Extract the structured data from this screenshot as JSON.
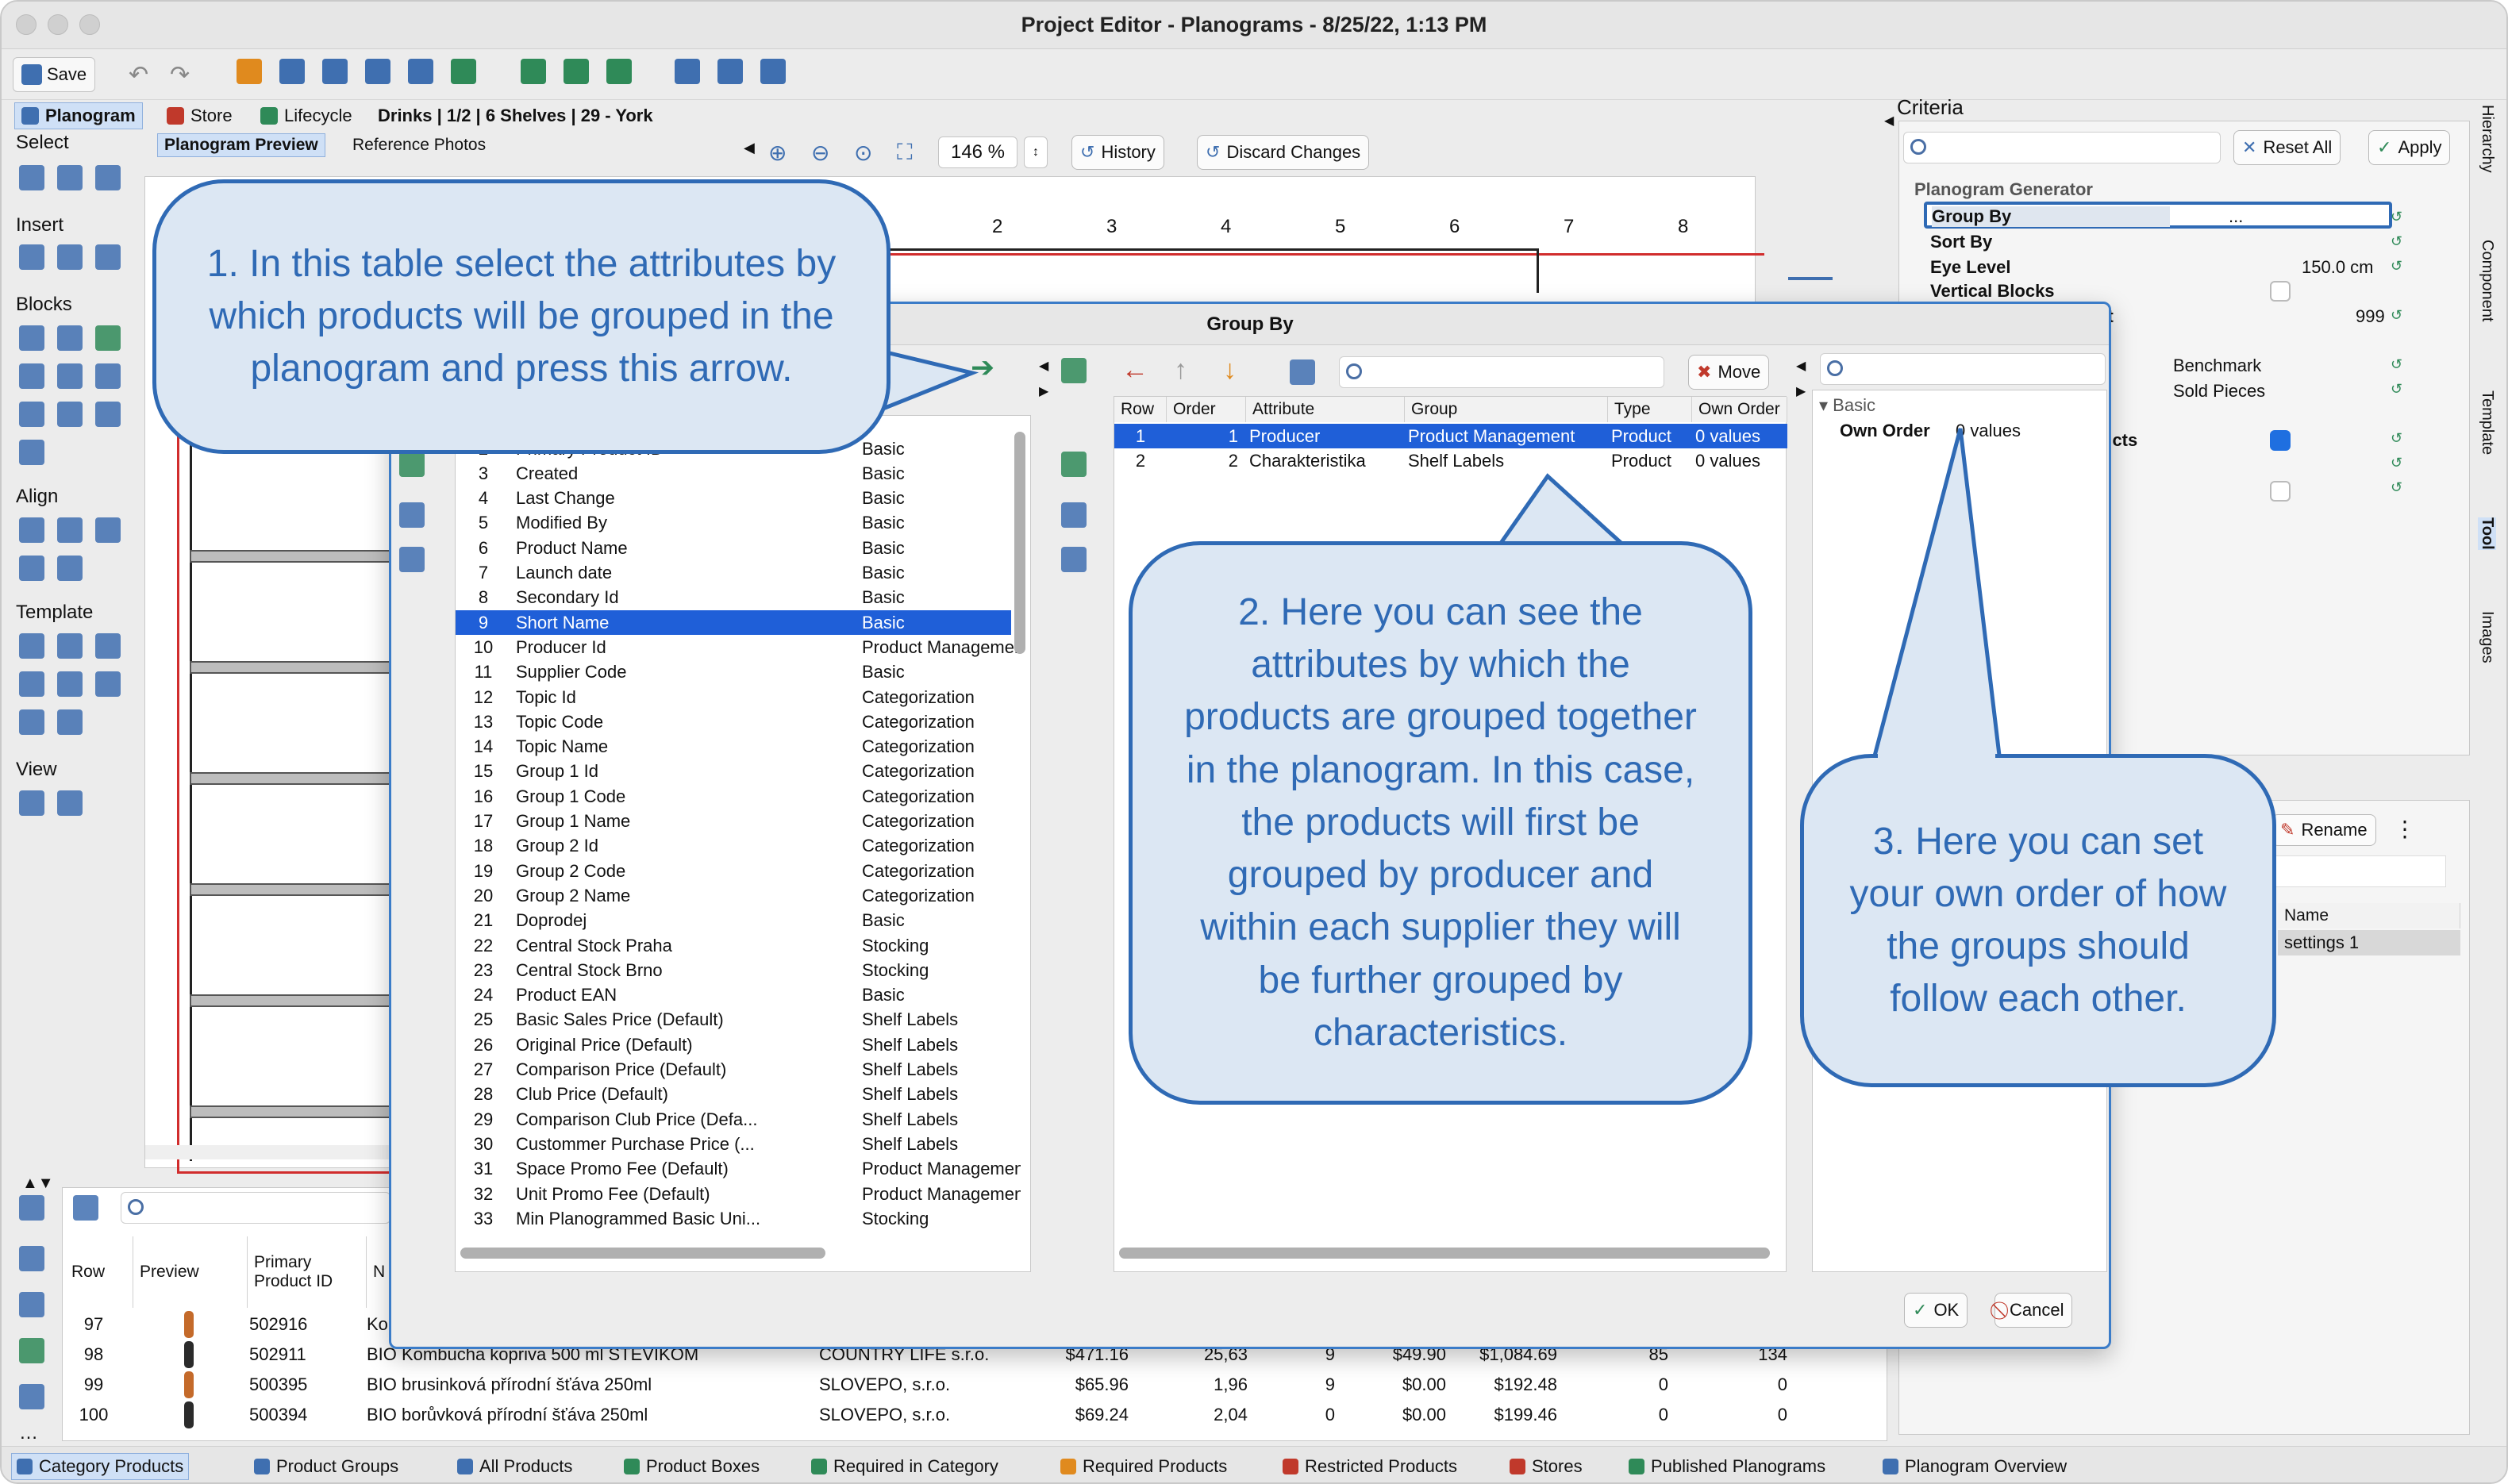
{
  "window": {
    "title": "Project Editor - Planograms - 8/25/22, 1:13 PM"
  },
  "toolbar": {
    "save_label": "Save"
  },
  "tabs": {
    "planogram": "Planogram",
    "store": "Store",
    "lifecycle": "Lifecycle",
    "path": "Drinks | 1/2 | 6 Shelves | 29 - York",
    "preview": "Planogram Preview",
    "photos": "Reference Photos"
  },
  "zoom": {
    "value": "146 %"
  },
  "actions": {
    "history": "History",
    "discard": "Discard Changes"
  },
  "sections": {
    "select": "Select",
    "insert": "Insert",
    "blocks": "Blocks",
    "align": "Align",
    "template": "Template",
    "view": "View"
  },
  "ruler": [
    "2",
    "3",
    "4",
    "5",
    "6",
    "7",
    "8"
  ],
  "criteria": {
    "title": "Criteria",
    "reset": "Reset All",
    "apply": "Apply",
    "generator": "Planogram Generator",
    "rows": [
      {
        "label": "Group By",
        "value": "..."
      },
      {
        "label": "Sort By",
        "value": ""
      },
      {
        "label": "Eye Level",
        "value": "150.0 cm"
      },
      {
        "label": "Vertical Blocks",
        "value": ""
      }
    ],
    "ht_label": "ht",
    "ht_value": "999",
    "benchmark": "Benchmark",
    "sold": "Sold Pieces",
    "ucts": "ucts"
  },
  "right_lower": {
    "rename": "Rename",
    "name_header": "Name",
    "name_value": "settings 1"
  },
  "side_tabs": [
    "Hierarchy",
    "Component",
    "Template",
    "Tool",
    "Images"
  ],
  "dialog": {
    "title": "Group By",
    "move": "Move",
    "ok": "OK",
    "cancel": "Cancel",
    "left_rows": [
      {
        "n": "2",
        "name": "Primary Product ID",
        "group": "Basic"
      },
      {
        "n": "3",
        "name": "Created",
        "group": "Basic"
      },
      {
        "n": "4",
        "name": "Last Change",
        "group": "Basic"
      },
      {
        "n": "5",
        "name": "Modified By",
        "group": "Basic"
      },
      {
        "n": "6",
        "name": "Product Name",
        "group": "Basic"
      },
      {
        "n": "7",
        "name": "Launch date",
        "group": "Basic"
      },
      {
        "n": "8",
        "name": "Secondary Id",
        "group": "Basic"
      },
      {
        "n": "9",
        "name": "Short Name",
        "group": "Basic"
      },
      {
        "n": "10",
        "name": "Producer Id",
        "group": "Product Management"
      },
      {
        "n": "11",
        "name": "Supplier Code",
        "group": "Basic"
      },
      {
        "n": "12",
        "name": "Topic Id",
        "group": "Categorization"
      },
      {
        "n": "13",
        "name": "Topic Code",
        "group": "Categorization"
      },
      {
        "n": "14",
        "name": "Topic Name",
        "group": "Categorization"
      },
      {
        "n": "15",
        "name": "Group 1 Id",
        "group": "Categorization"
      },
      {
        "n": "16",
        "name": "Group 1 Code",
        "group": "Categorization"
      },
      {
        "n": "17",
        "name": "Group 1 Name",
        "group": "Categorization"
      },
      {
        "n": "18",
        "name": "Group 2 Id",
        "group": "Categorization"
      },
      {
        "n": "19",
        "name": "Group 2 Code",
        "group": "Categorization"
      },
      {
        "n": "20",
        "name": "Group 2 Name",
        "group": "Categorization"
      },
      {
        "n": "21",
        "name": "Doprodej",
        "group": "Basic"
      },
      {
        "n": "22",
        "name": "Central Stock Praha",
        "group": "Stocking"
      },
      {
        "n": "23",
        "name": "Central Stock Brno",
        "group": "Stocking"
      },
      {
        "n": "24",
        "name": "Product EAN",
        "group": "Basic"
      },
      {
        "n": "25",
        "name": "Basic Sales Price (Default)",
        "group": "Shelf Labels"
      },
      {
        "n": "26",
        "name": "Original Price (Default)",
        "group": "Shelf Labels"
      },
      {
        "n": "27",
        "name": "Comparison Price (Default)",
        "group": "Shelf Labels"
      },
      {
        "n": "28",
        "name": "Club Price (Default)",
        "group": "Shelf Labels"
      },
      {
        "n": "29",
        "name": "Comparison Club Price (Defa...",
        "group": "Shelf Labels"
      },
      {
        "n": "30",
        "name": "Custommer Purchase Price (...",
        "group": "Shelf Labels"
      },
      {
        "n": "31",
        "name": "Space Promo Fee (Default)",
        "group": "Product Management"
      },
      {
        "n": "32",
        "name": "Unit Promo Fee (Default)",
        "group": "Product Management"
      },
      {
        "n": "33",
        "name": "Min Planogrammed Basic Uni...",
        "group": "Stocking"
      }
    ],
    "mid_headers": [
      "Row",
      "Order",
      "Attribute",
      "Group",
      "Type",
      "Own Order"
    ],
    "mid_rows": [
      {
        "row": "1",
        "order": "1",
        "attr": "Producer",
        "group": "Product Management",
        "type": "Product",
        "own": "0 values"
      },
      {
        "row": "2",
        "order": "2",
        "attr": "Charakteristika",
        "group": "Shelf Labels",
        "type": "Product",
        "own": "0 values"
      }
    ],
    "basic_label": "Basic",
    "own_order_label": "Own Order",
    "own_order_value": "0 values"
  },
  "bottom_table": {
    "headers": [
      "Row",
      "Preview",
      "Primary Product ID",
      "N"
    ],
    "rows": [
      {
        "row": "97",
        "id": "502916",
        "name": "Ko",
        "supplier": "",
        "price": "",
        "a": "",
        "b": "",
        "c": "",
        "d": "",
        "e": "",
        "f": ""
      },
      {
        "row": "98",
        "id": "502911",
        "name": "BIO Kombucha kopriva 500 ml STEVIKOM",
        "supplier": "COUNTRY LIFE s.r.o.",
        "price": "$471.16",
        "a": "25,63",
        "b": "9",
        "c": "$49.90",
        "d": "$1,084.69",
        "e": "85",
        "f": "134"
      },
      {
        "row": "99",
        "id": "500395",
        "name": "BIO brusinková přírodní šťáva 250ml",
        "supplier": "SLOVEPO, s.r.o.",
        "price": "$65.96",
        "a": "1,96",
        "b": "9",
        "c": "$0.00",
        "d": "$192.48",
        "e": "0",
        "f": "0"
      },
      {
        "row": "100",
        "id": "500394",
        "name": "BIO borůvková přírodní šťáva 250ml",
        "supplier": "SLOVEPO, s.r.o.",
        "price": "$69.24",
        "a": "2,04",
        "b": "0",
        "c": "$0.00",
        "d": "$199.46",
        "e": "0",
        "f": "0"
      }
    ]
  },
  "bottom_tabs": [
    "Category Products",
    "Product Groups",
    "All Products",
    "Product Boxes",
    "Required in Category",
    "Required Products",
    "Restricted Products",
    "Stores",
    "Published Planograms",
    "Planogram Overview"
  ],
  "callouts": {
    "c1": "1. In this table select the attributes by which products will be grouped in the planogram and press this arrow.",
    "c2": "2. Here you can see the attributes by which the products are grouped together in the planogram. In this case, the products will first be grouped by producer and within each supplier they will be further grouped by characteristics.",
    "c3": "3. Here you can set your own order of how the groups should follow each other."
  },
  "colors": {
    "accent": "#2f6ab5",
    "selection": "#1f5fd8",
    "callout_fill": "#dce7f3"
  }
}
